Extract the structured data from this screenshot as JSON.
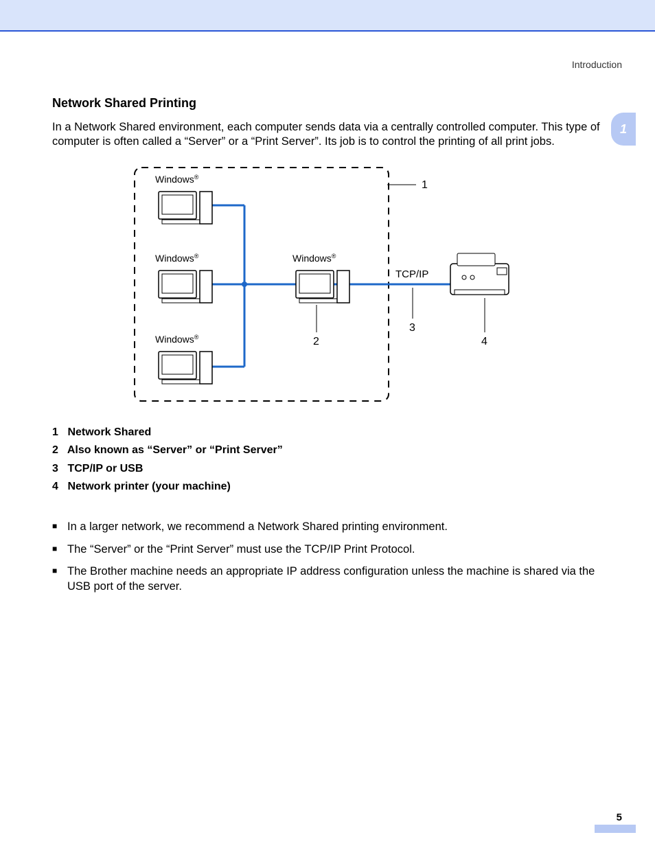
{
  "header": {
    "section": "Introduction",
    "chapter": "1"
  },
  "subheading": "Network Shared Printing",
  "intro": "In a Network Shared environment, each computer sends data via a centrally controlled computer. This type of computer is often called a “Server” or a “Print Server”. Its job is to control the printing of all print jobs.",
  "diagram": {
    "labels": {
      "client1": "Windows",
      "client2": "Windows",
      "client3": "Windows",
      "server": "Windows",
      "protocol": "TCP/IP",
      "callout1": "1",
      "callout2": "2",
      "callout3": "3",
      "callout4": "4"
    }
  },
  "legend": [
    {
      "n": "1",
      "text": "Network Shared"
    },
    {
      "n": "2",
      "text": "Also known as “Server” or “Print Server”"
    },
    {
      "n": "3",
      "text": "TCP/IP or USB"
    },
    {
      "n": "4",
      "text": "Network printer (your machine)"
    }
  ],
  "bullets": [
    "In a larger network, we recommend a Network Shared printing environment.",
    "The “Server” or the “Print Server” must use the TCP/IP Print Protocol.",
    "The Brother machine needs an appropriate IP address configuration unless the machine is shared via the USB port of the server."
  ],
  "page_number": "5"
}
